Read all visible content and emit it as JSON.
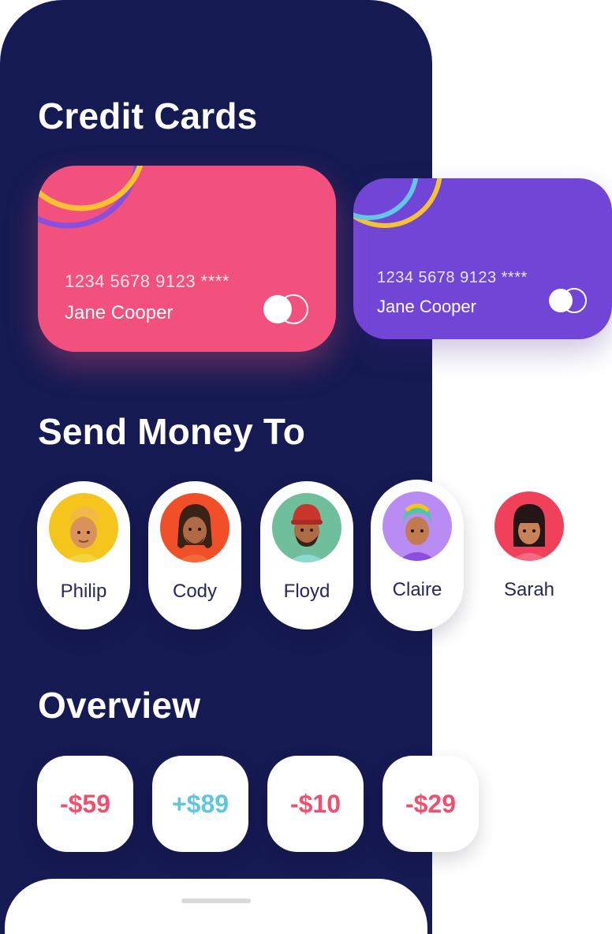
{
  "sections": {
    "credit_cards_title": "Credit Cards",
    "send_money_title": "Send Money To",
    "overview_title": "Overview"
  },
  "cards": [
    {
      "number": "1234 5678 9123 ****",
      "holder": "Jane Cooper",
      "color": "#f2507d",
      "brand_icon": "card-network-icon"
    },
    {
      "number": "1234 5678 9123 ****",
      "holder": "Jane Cooper",
      "color": "#7146d6",
      "brand_icon": "card-network-icon"
    }
  ],
  "contacts": [
    {
      "name": "Philip",
      "avatar_bg": "#f5c51e"
    },
    {
      "name": "Cody",
      "avatar_bg": "#f04f28"
    },
    {
      "name": "Floyd",
      "avatar_bg": "#6fbf9c"
    },
    {
      "name": "Claire",
      "avatar_bg": "#b88cf2"
    },
    {
      "name": "Sarah",
      "avatar_bg": "#f0405a"
    }
  ],
  "overview": [
    {
      "amount": "-$59",
      "color": "#f0506f"
    },
    {
      "amount": "+$89",
      "color": "#5fc6e0"
    },
    {
      "amount": "-$10",
      "color": "#f0506f"
    },
    {
      "amount": "-$29",
      "color": "#f0506f"
    }
  ],
  "theme": {
    "background": "#161a52",
    "accent_pink": "#f2507d",
    "accent_purple": "#7146d6"
  }
}
